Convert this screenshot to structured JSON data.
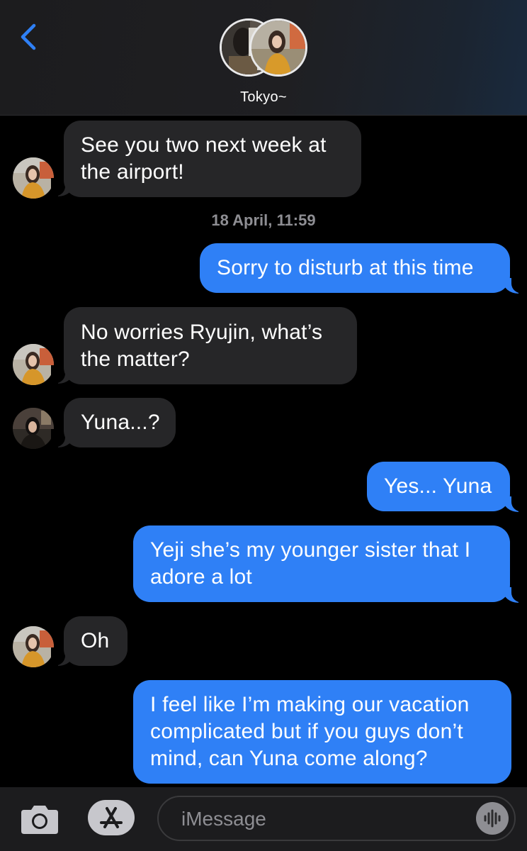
{
  "header": {
    "group_name": "Tokyo~"
  },
  "messages": [
    {
      "direction": "incoming",
      "sender_avatar": "yeji",
      "lines": [
        "See you two next week at",
        "the airport!"
      ]
    },
    {
      "timestamp": "18 April, 11:59"
    },
    {
      "direction": "outgoing",
      "lines": [
        "Sorry to disturb at this time"
      ]
    },
    {
      "direction": "incoming",
      "sender_avatar": "yeji",
      "lines": [
        "No worries Ryujin, what’s",
        "the matter?"
      ]
    },
    {
      "direction": "incoming",
      "sender_avatar": "chaeryeong",
      "lines": [
        "Yuna...?"
      ]
    },
    {
      "direction": "outgoing",
      "lines": [
        "Yes... Yuna"
      ]
    },
    {
      "direction": "outgoing",
      "lines": [
        "Yeji she’s my younger sister that I",
        "adore a lot"
      ]
    },
    {
      "direction": "incoming",
      "sender_avatar": "yeji",
      "lines": [
        "Oh"
      ]
    },
    {
      "direction": "outgoing",
      "lines": [
        "I feel like I’m making our vacation",
        "complicated but if you guys don’t",
        "mind, can Yuna come along?"
      ]
    }
  ],
  "input": {
    "placeholder": "iMessage"
  },
  "icons": {
    "back": "chevron-left-icon",
    "camera": "camera-icon",
    "apps": "app-store-icon",
    "audio": "audio-waveform-icon"
  },
  "colors": {
    "accent": "#2f80f6",
    "incoming_bubble": "#262628",
    "back_chevron": "#2f80f6"
  }
}
